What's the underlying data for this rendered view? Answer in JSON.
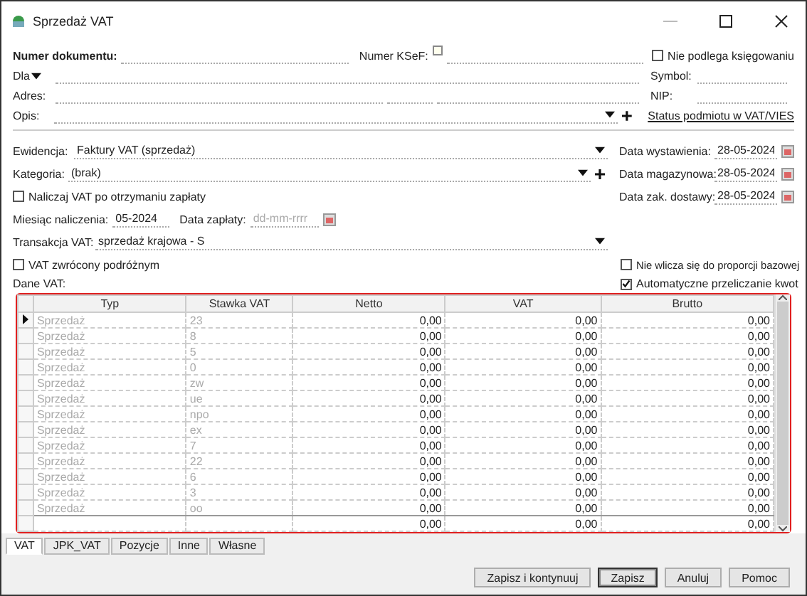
{
  "window": {
    "title": "Sprzedaż VAT"
  },
  "document": {
    "number_label": "Numer dokumentu:",
    "ksef_label": "Numer KSeF:",
    "not_booked": {
      "label": "Nie podlega księgowaniu",
      "checked": false
    }
  },
  "contractor": {
    "for_label": "Dla",
    "symbol_label": "Symbol:",
    "address_label": "Adres:",
    "nip_label": "NIP:",
    "description_label": "Opis:",
    "vies_link": "Status podmiotu w VAT/VIES"
  },
  "register": {
    "label": "Ewidencja:",
    "value": "Faktury VAT (sprzedaż)"
  },
  "category": {
    "label": "Kategoria:",
    "value": "(brak)"
  },
  "dates": [
    {
      "label": "Data wystawienia:",
      "value": "28-05-2024"
    },
    {
      "label": "Data magazynowa:",
      "value": "28-05-2024"
    },
    {
      "label": "Data zak. dostawy:",
      "value": "28-05-2024"
    }
  ],
  "vat_on_payment": {
    "label": "Naliczaj VAT po otrzymaniu zapłaty",
    "checked": false
  },
  "accrual_month": {
    "label": "Miesiąc naliczenia:",
    "value": "05-2024"
  },
  "payment_date": {
    "label": "Data zapłaty:",
    "placeholder": "dd-mm-rrrr"
  },
  "vat_transaction": {
    "label": "Transakcja VAT:",
    "value": "sprzedaż krajowa - S"
  },
  "checkboxes": [
    {
      "label": "VAT zwrócony podróżnym",
      "checked": false
    },
    {
      "label": "Nie wlicza się do proporcji bazowej",
      "checked": false
    },
    {
      "label": "Automatyczne przeliczanie kwot",
      "checked": true
    }
  ],
  "vat_data_label": "Dane VAT:",
  "table": {
    "columns": [
      "Typ",
      "Stawka VAT",
      "Netto",
      "VAT",
      "Brutto"
    ],
    "rows": [
      {
        "cells": [
          "Sprzedaż",
          "23",
          "0,00",
          "0,00",
          "0,00"
        ],
        "selected": true
      },
      {
        "cells": [
          "Sprzedaż",
          "8",
          "0,00",
          "0,00",
          "0,00"
        ],
        "selected": false
      },
      {
        "cells": [
          "Sprzedaż",
          "5",
          "0,00",
          "0,00",
          "0,00"
        ],
        "selected": false
      },
      {
        "cells": [
          "Sprzedaż",
          "0",
          "0,00",
          "0,00",
          "0,00"
        ],
        "selected": false
      },
      {
        "cells": [
          "Sprzedaż",
          "zw",
          "0,00",
          "0,00",
          "0,00"
        ],
        "selected": false
      },
      {
        "cells": [
          "Sprzedaż",
          "ue",
          "0,00",
          "0,00",
          "0,00"
        ],
        "selected": false
      },
      {
        "cells": [
          "Sprzedaż",
          "npo",
          "0,00",
          "0,00",
          "0,00"
        ],
        "selected": false
      },
      {
        "cells": [
          "Sprzedaż",
          "ex",
          "0,00",
          "0,00",
          "0,00"
        ],
        "selected": false
      },
      {
        "cells": [
          "Sprzedaż",
          "7",
          "0,00",
          "0,00",
          "0,00"
        ],
        "selected": false
      },
      {
        "cells": [
          "Sprzedaż",
          "22",
          "0,00",
          "0,00",
          "0,00"
        ],
        "selected": false
      },
      {
        "cells": [
          "Sprzedaż",
          "6",
          "0,00",
          "0,00",
          "0,00"
        ],
        "selected": false
      },
      {
        "cells": [
          "Sprzedaż",
          "3",
          "0,00",
          "0,00",
          "0,00"
        ],
        "selected": false
      },
      {
        "cells": [
          "Sprzedaż",
          "oo",
          "0,00",
          "0,00",
          "0,00"
        ],
        "selected": false
      }
    ],
    "totals": [
      "0,00",
      "0,00",
      "0,00"
    ]
  },
  "tabs": [
    {
      "label": "VAT",
      "selected": true
    },
    {
      "label": "JPK_VAT",
      "selected": false
    },
    {
      "label": "Pozycje",
      "selected": false
    },
    {
      "label": "Inne",
      "selected": false
    },
    {
      "label": "Własne",
      "selected": false
    }
  ],
  "buttons": [
    {
      "label": "Zapisz i kontynuuj",
      "default": false
    },
    {
      "label": "Zapisz",
      "default": true
    },
    {
      "label": "Anuluj",
      "default": false
    },
    {
      "label": "Pomoc",
      "default": false
    }
  ]
}
